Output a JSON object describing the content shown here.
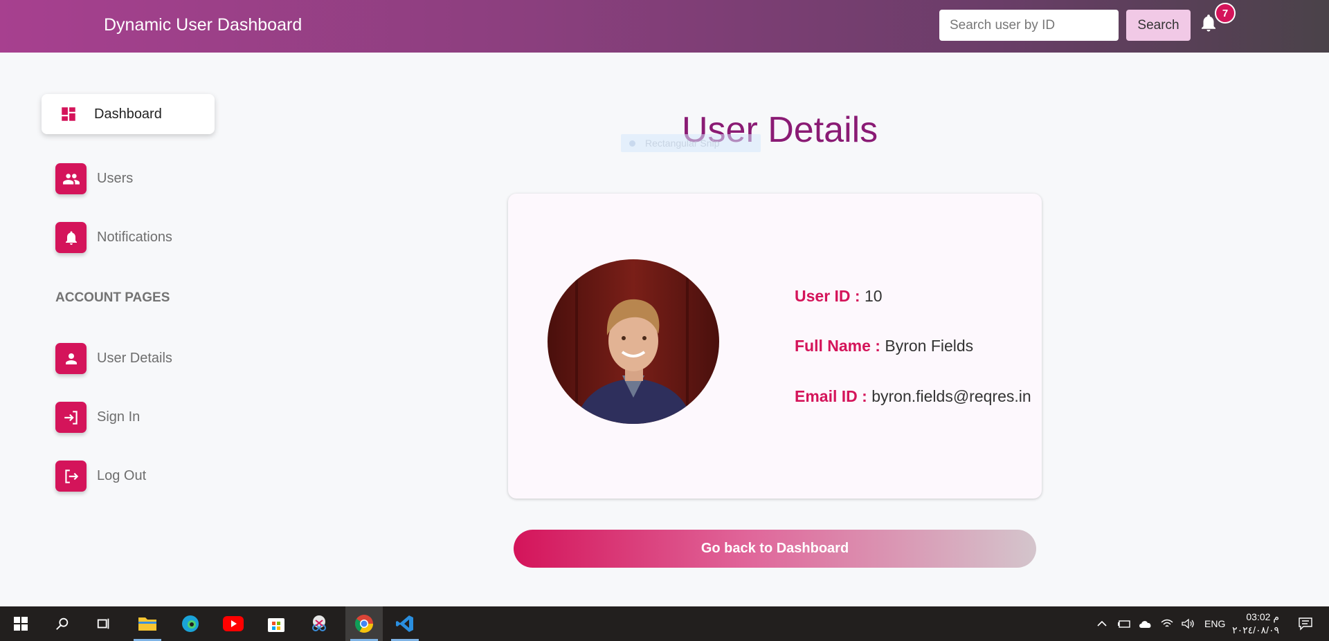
{
  "header": {
    "title": "Dynamic User Dashboard",
    "search_placeholder": "Search user by ID",
    "search_value": "",
    "search_label": "Search",
    "notification_count": "7"
  },
  "sidebar": {
    "dashboard": {
      "label": "Dashboard",
      "icon": "dashboard-icon"
    },
    "items": [
      {
        "label": "Users",
        "icon": "users-icon"
      },
      {
        "label": "Notifications",
        "icon": "bell-icon"
      }
    ],
    "account_title": "ACCOUNT PAGES",
    "account_items": [
      {
        "label": "User Details",
        "icon": "person-icon"
      },
      {
        "label": "Sign In",
        "icon": "sign-in-icon"
      },
      {
        "label": "Log Out",
        "icon": "log-out-icon"
      }
    ]
  },
  "main": {
    "page_title": "User Details",
    "overlay_chip": "Rectangular Snip",
    "user": {
      "id_label": "User ID :",
      "id": "10",
      "name_label": "Full Name :",
      "name": "Byron Fields",
      "email_label": "Email ID :",
      "email": "byron.fields@reqres.in"
    },
    "back_label": "Go back to Dashboard"
  },
  "taskbar": {
    "apps": [
      "start-icon",
      "search-icon",
      "task-view-icon",
      "file-explorer-icon",
      "edge-icon",
      "youtube-icon",
      "store-icon",
      "snip-icon",
      "chrome-icon",
      "vscode-icon"
    ],
    "language": "ENG",
    "time": "03:02 م",
    "date": "٢٠٢٤/٠٨/٠٩"
  },
  "colors": {
    "accent": "#d4145a",
    "title": "#8a1b74",
    "header_start": "#a7408f",
    "header_end": "#4a4249"
  }
}
